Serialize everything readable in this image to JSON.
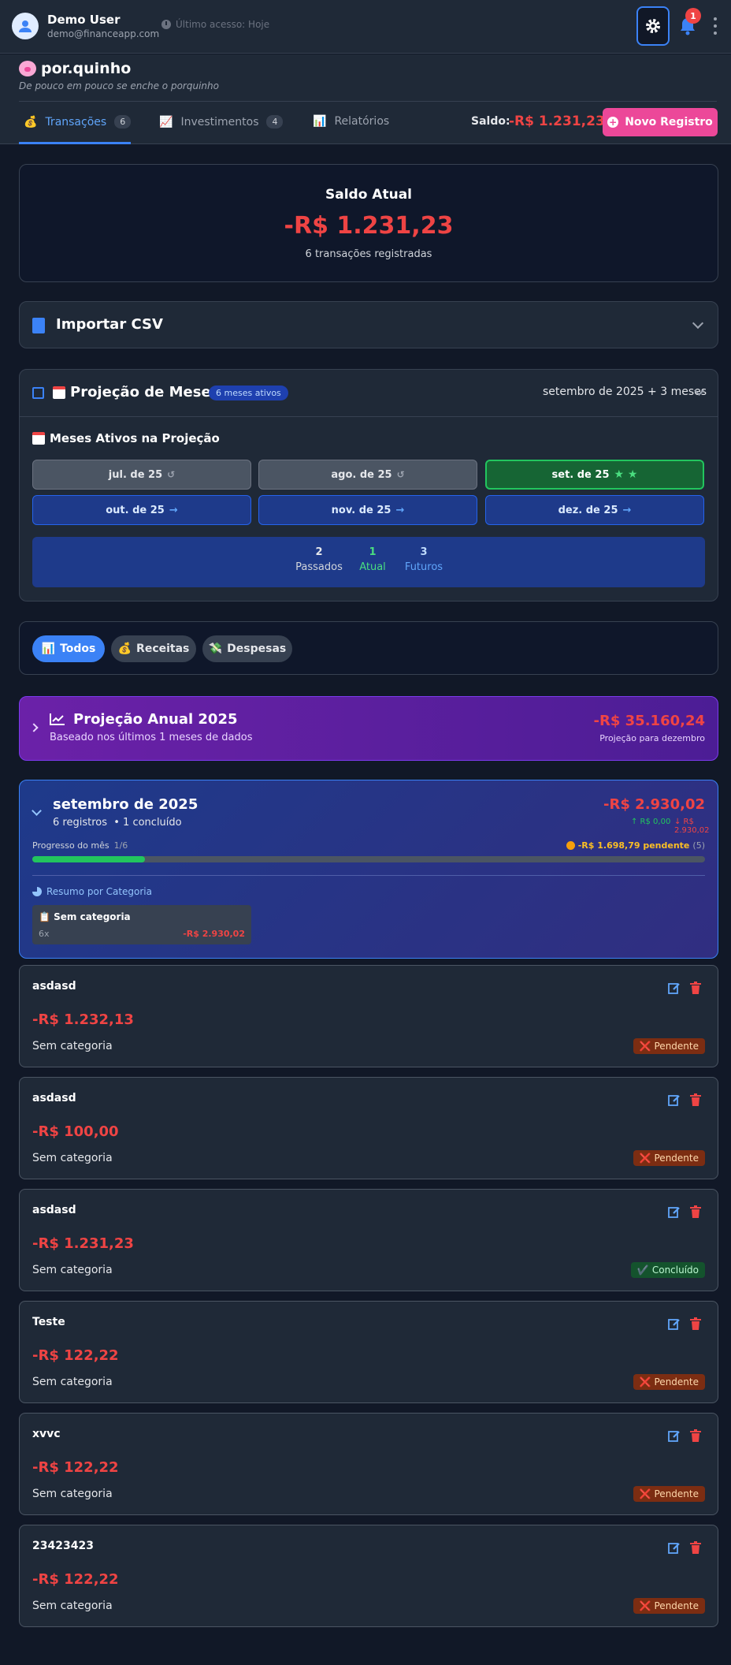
{
  "user": {
    "name": "Demo User",
    "email": "demo@financeapp.com",
    "last_access": "Último acesso: Hoje",
    "notifications": "1"
  },
  "brand": {
    "name": "por.quinho",
    "tagline": "De pouco em pouco se enche o porquinho"
  },
  "tabs": [
    {
      "icon": "💰",
      "label": "Transações",
      "count": "6"
    },
    {
      "icon": "📈",
      "label": "Investimentos",
      "count": "4"
    },
    {
      "icon": "📊",
      "label": "Relatórios"
    }
  ],
  "header": {
    "saldo_label": "Saldo:",
    "saldo_value": "-R$ 1.231,23",
    "new_button": "Novo Registro"
  },
  "saldo_card": {
    "title": "Saldo Atual",
    "value": "-R$ 1.231,23",
    "subtitle": "6 transações registradas"
  },
  "csv": {
    "label": "Importar CSV"
  },
  "projection": {
    "title": "Projeção de Meses",
    "pill": "6 meses ativos",
    "range": "setembro de 2025 + 3 meses",
    "active_title": "Meses Ativos na Projeção",
    "months": [
      {
        "label": "jul. de 25",
        "state": "past"
      },
      {
        "label": "ago. de 25",
        "state": "past"
      },
      {
        "label": "set. de 25",
        "state": "current"
      },
      {
        "label": "out. de 25",
        "state": "future"
      },
      {
        "label": "nov. de 25",
        "state": "future"
      },
      {
        "label": "dez. de 25",
        "state": "future"
      }
    ],
    "stats": [
      {
        "n": "2",
        "label": "Passados"
      },
      {
        "n": "1",
        "label": "Atual"
      },
      {
        "n": "3",
        "label": "Futuros"
      }
    ]
  },
  "filters": [
    {
      "icon": "📊",
      "label": "Todos"
    },
    {
      "icon": "💰",
      "label": "Receitas"
    },
    {
      "icon": "💸",
      "label": "Despesas"
    }
  ],
  "annual": {
    "title": "Projeção Anual 2025",
    "subtitle": "Baseado nos últimos 1 meses de dados",
    "value": "-R$ 35.160,24",
    "value_label": "Projeção para dezembro"
  },
  "month_card": {
    "title": "setembro de 2025",
    "registros": "6 registros",
    "concluidos": "• 1 concluído",
    "total": "-R$ 2.930,02",
    "income": "↑ R$ 0,00",
    "expense": "↓ R$ 2.930,02",
    "progress_label": "Progresso do mês",
    "progress_count": "1/6",
    "progress_fraction": 0.167,
    "pending": "-R$ 1.698,79 pendente",
    "pending_count": "(5)",
    "summary_title": "Resumo por Categoria",
    "category": {
      "icon": "📋",
      "name": "Sem categoria",
      "count": "6x",
      "value": "-R$ 2.930,02"
    }
  },
  "transactions": [
    {
      "name": "asdasd",
      "amount": "-R$ 1.232,13",
      "category": "Sem categoria",
      "status": "Pendente",
      "status_icon": "❌"
    },
    {
      "name": "asdasd",
      "amount": "-R$ 100,00",
      "category": "Sem categoria",
      "status": "Pendente",
      "status_icon": "❌"
    },
    {
      "name": "asdasd",
      "amount": "-R$ 1.231,23",
      "category": "Sem categoria",
      "status": "Concluído",
      "status_icon": "✔️"
    },
    {
      "name": "Teste",
      "amount": "-R$ 122,22",
      "category": "Sem categoria",
      "status": "Pendente",
      "status_icon": "❌"
    },
    {
      "name": "xvvc",
      "amount": "-R$ 122,22",
      "category": "Sem categoria",
      "status": "Pendente",
      "status_icon": "❌"
    },
    {
      "name": "23423423",
      "amount": "-R$ 122,22",
      "category": "Sem categoria",
      "status": "Pendente",
      "status_icon": "❌"
    }
  ],
  "colors": {
    "accent": "#3b82f6",
    "brand": "#ec4899",
    "negative": "#ef4444",
    "positive": "#22c55e"
  }
}
